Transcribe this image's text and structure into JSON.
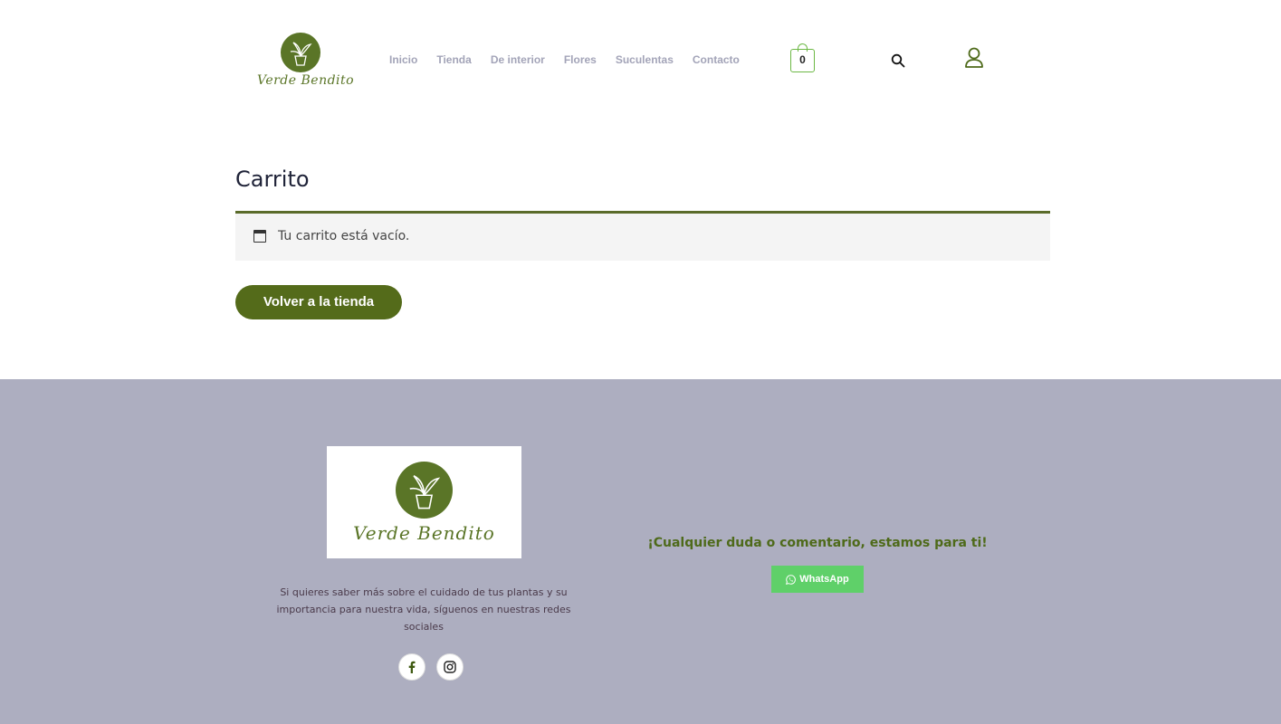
{
  "brand": {
    "name": "Verde Bendito",
    "accent_color": "#546b1a",
    "cart_color": "#6cb844",
    "whatsapp_color": "#5fd069",
    "footer_bg": "#adaec0"
  },
  "nav": {
    "items": [
      {
        "label": "Inicio"
      },
      {
        "label": "Tienda"
      },
      {
        "label": "De interior"
      },
      {
        "label": "Flores"
      },
      {
        "label": "Suculentas"
      },
      {
        "label": "Contacto"
      }
    ]
  },
  "header": {
    "cart_count": "0",
    "cart_icon": "shopping-bag-icon",
    "search_icon": "search-icon",
    "user_icon": "user-icon"
  },
  "main": {
    "title": "Carrito",
    "notice_icon": "calendar-icon",
    "notice": "Tu carrito está vacío.",
    "back_button": "Volver a la tienda"
  },
  "footer": {
    "description": "Si quieres saber más sobre el cuidado de tus plantas y su importancia para nuestra vida, síguenos en nuestras redes sociales",
    "cta": "¡Cualquier duda o comentario, estamos para ti!",
    "whatsapp_label": "WhatsApp",
    "social_icons": [
      "facebook-icon",
      "instagram-icon"
    ]
  }
}
